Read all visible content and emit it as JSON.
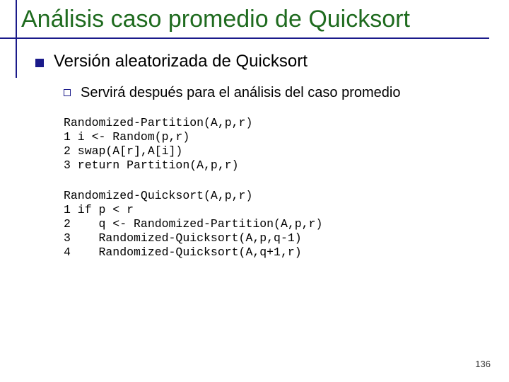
{
  "title": "Análisis caso promedio de Quicksort",
  "lvl1_text": "Versión aleatorizada de Quicksort",
  "lvl2_text": "Servirá después para el análisis del caso promedio",
  "code1": "Randomized-Partition(A,p,r)\n1 i <- Random(p,r)\n2 swap(A[r],A[i])\n3 return Partition(A,p,r)",
  "code2": "Randomized-Quicksort(A,p,r)\n1 if p < r\n2    q <- Randomized-Partition(A,p,r)\n3    Randomized-Quicksort(A,p,q-1)\n4    Randomized-Quicksort(A,q+1,r)",
  "page_number": "136"
}
